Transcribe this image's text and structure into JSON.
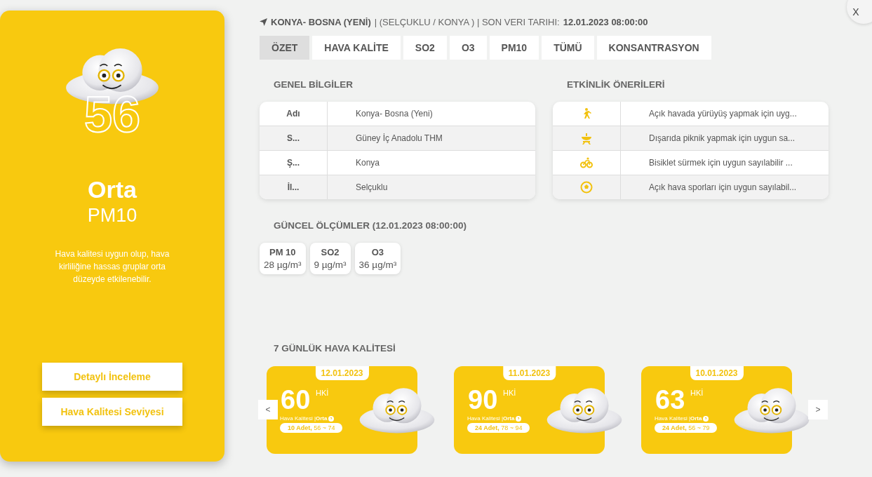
{
  "summary": {
    "index": "56",
    "level": "Orta",
    "pollutant": "PM10",
    "description": "Hava kalitesi uygun olup, hava kirliliğine hassas gruplar orta düzeyde etkilenebilir.",
    "buttons": [
      "Detaylı İnceleme",
      "Hava Kalitesi Seviyesi"
    ]
  },
  "header": {
    "station": "KONYA- BOSNA (YENİ)",
    "details": "| (SELÇUKLU / KONYA ) | SON VERI TARIHI:",
    "date": "12.01.2023 08:00:00"
  },
  "close": "X",
  "tabs": [
    {
      "label": "ÖZET",
      "selected": true
    },
    {
      "label": "HAVA KALİTE",
      "selected": false
    },
    {
      "label": "SO2",
      "selected": false
    },
    {
      "label": "O3",
      "selected": false
    },
    {
      "label": "PM10",
      "selected": false
    },
    {
      "label": "TÜMÜ",
      "selected": false
    },
    {
      "label": "KONSANTRASYON",
      "selected": false
    }
  ],
  "general_info": {
    "title": "GENEL BİLGİLER",
    "rows": [
      {
        "label": "Adı",
        "value": "Konya- Bosna (Yeni)"
      },
      {
        "label": "S...",
        "value": "Güney İç Anadolu THM"
      },
      {
        "label": "Ş...",
        "value": "Konya"
      },
      {
        "label": "İl...",
        "value": "Selçuklu"
      }
    ]
  },
  "activities": {
    "title": "ETKİNLİK ÖNERİLERİ",
    "rows": [
      {
        "kind": "walk",
        "text": "Açık havada yürüyüş yapmak için uyg..."
      },
      {
        "kind": "picnic",
        "text": "Dışarıda piknik yapmak için uygun sa..."
      },
      {
        "kind": "bike",
        "text": "Bisiklet sürmek için uygun sayılabilir ..."
      },
      {
        "kind": "ball",
        "text": "Açık hava sporları için uygun sayılabil..."
      }
    ]
  },
  "measurements": {
    "title": "GÜNCEL ÖLÇÜMLER (12.01.2023 08:00:00)",
    "items": [
      {
        "name": "PM 10",
        "value": "28 µg/m³"
      },
      {
        "name": "SO2",
        "value": "9 µg/m³"
      },
      {
        "name": "O3",
        "value": "36 µg/m³"
      }
    ]
  },
  "forecast": {
    "title": "7 GÜNLÜK HAVA KALİTESİ",
    "prev": "<",
    "next": ">",
    "days": [
      {
        "date": "12.01.2023",
        "value": "60",
        "unit": "HKİ",
        "quality": "Hava Kalitesi |**Orta**",
        "range": "**10 Adet,** 56 ~ 74"
      },
      {
        "date": "11.01.2023",
        "value": "90",
        "unit": "HKİ",
        "quality": "Hava Kalitesi |**Orta**",
        "range": "**24 Adet,** 78 ~ 94"
      },
      {
        "date": "10.01.2023",
        "value": "63",
        "unit": "HKİ",
        "quality": "Hava Kalitesi |**Orta**",
        "range": "**24 Adet,** 56 ~ 79"
      }
    ]
  }
}
